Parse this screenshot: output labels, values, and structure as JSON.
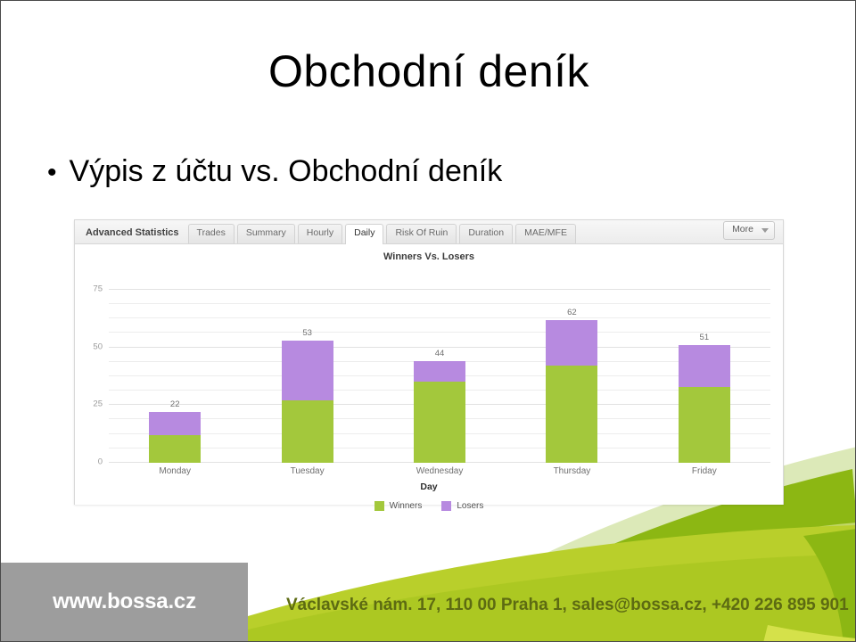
{
  "slide": {
    "title": "Obchodní deník",
    "bullet_marker": "•",
    "bullet_text": "Výpis z účtu vs. Obchodní deník"
  },
  "panel": {
    "app_title": "Advanced Statistics",
    "tabs": [
      {
        "label": "Trades",
        "active": false
      },
      {
        "label": "Summary",
        "active": false
      },
      {
        "label": "Hourly",
        "active": false
      },
      {
        "label": "Daily",
        "active": true
      },
      {
        "label": "Risk Of Ruin",
        "active": false
      },
      {
        "label": "Duration",
        "active": false
      },
      {
        "label": "MAE/MFE",
        "active": false
      }
    ],
    "more_button": "More",
    "more_icon": "chevron-down-icon"
  },
  "chart_data": {
    "type": "bar",
    "title": "Winners Vs. Losers",
    "xlabel": "Day",
    "ylabel": "",
    "stacked": true,
    "grid": true,
    "legend_position": "bottom",
    "ylim": [
      0,
      80
    ],
    "yticks": [
      0,
      25,
      50,
      75
    ],
    "categories": [
      "Monday",
      "Tuesday",
      "Wednesday",
      "Thursday",
      "Friday"
    ],
    "totals": [
      22,
      53,
      44,
      62,
      51
    ],
    "series": [
      {
        "name": "Winners",
        "color": "#a3c83c",
        "values": [
          12,
          27,
          35,
          42,
          33
        ]
      },
      {
        "name": "Losers",
        "color": "#b78ae0",
        "values": [
          10,
          26,
          9,
          20,
          18
        ]
      }
    ]
  },
  "footer": {
    "url": "www.bossa.cz",
    "contact": "Václavské nám. 17, 110 00 Praha 1, sales@bossa.cz, +420 226 895 901"
  },
  "colors": {
    "winners": "#a3c83c",
    "losers": "#b78ae0",
    "brand_green": "#8cb713",
    "brand_green_light": "#b9cf2b",
    "footer_gray": "#9d9d9d",
    "footer_text": "#5d6b12"
  }
}
